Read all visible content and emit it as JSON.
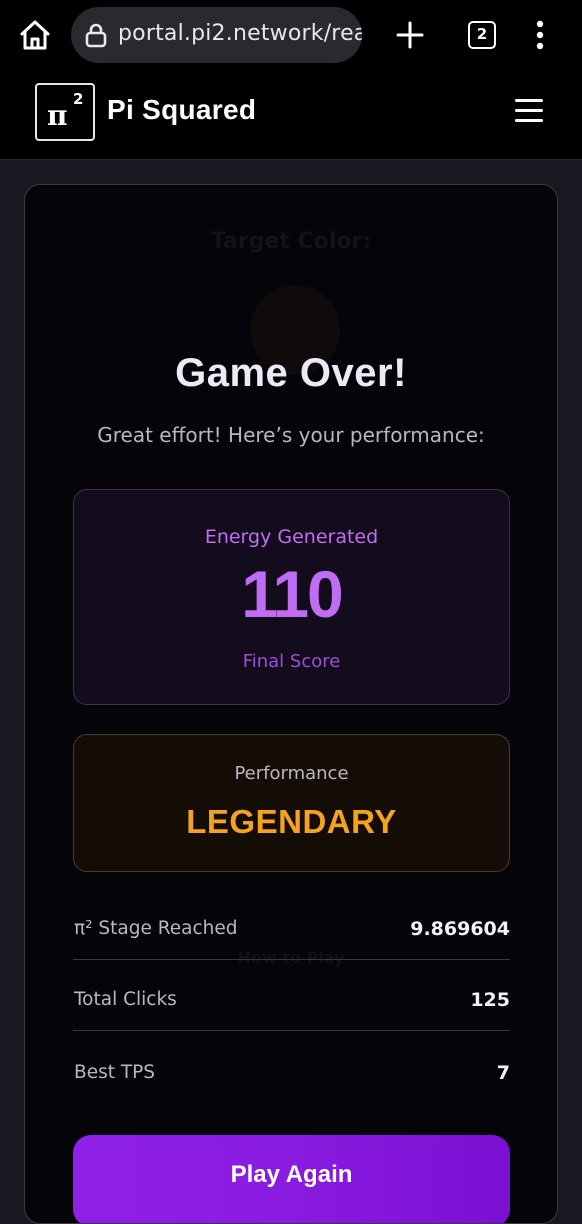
{
  "browser": {
    "url": "portal.pi2.network/rea",
    "tab_count": "2",
    "icons": [
      "home-icon",
      "lock-icon",
      "plus-icon",
      "tab-switcher-icon",
      "more-vert-icon"
    ]
  },
  "header": {
    "logo_symbol": "π",
    "logo_superscript": "2",
    "brand_name": "Pi Squared",
    "menu_icon": "hamburger-icon"
  },
  "background_game": {
    "title": "Target Color:",
    "how_to": "How to Play"
  },
  "game_over": {
    "title": "Game Over!",
    "subtitle": "Great effort! Here’s your performance:",
    "score": {
      "label": "Energy Generated",
      "value": "110",
      "sublabel": "Final Score"
    },
    "performance": {
      "label": "Performance",
      "value": "LEGENDARY"
    },
    "stats": [
      {
        "label": "π² Stage Reached",
        "value": "9.869604"
      },
      {
        "label": "Total Clicks",
        "value": "125"
      },
      {
        "label": "Best TPS",
        "value": "7"
      }
    ],
    "play_again_label": "Play Again"
  },
  "colors": {
    "accent_purple": "#c06cf3",
    "legendary_orange": "#f5a31f",
    "button_purple": "#8a1be0"
  }
}
